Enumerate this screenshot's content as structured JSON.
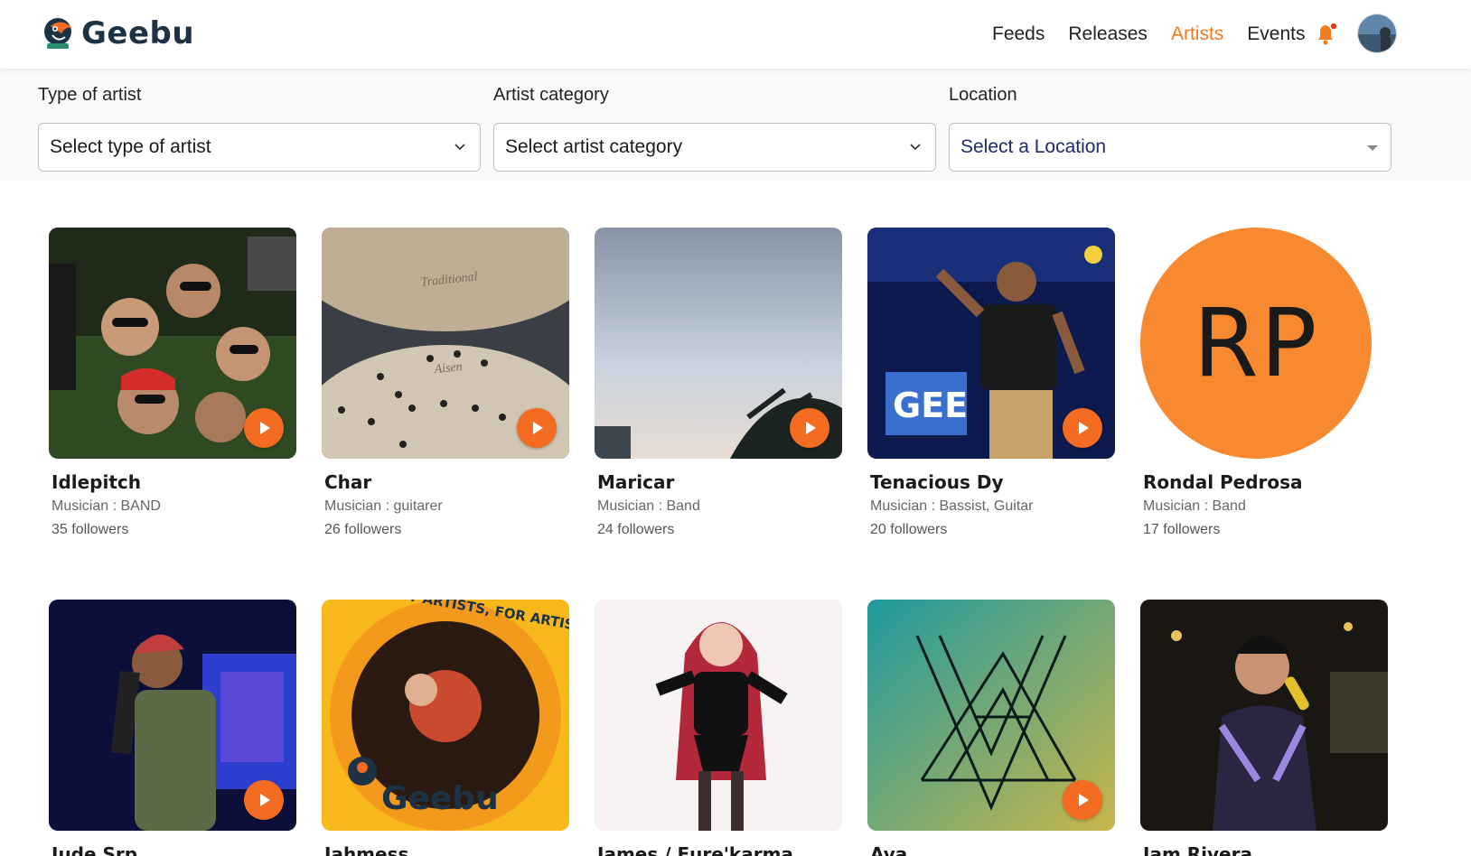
{
  "brand": {
    "name": "Geebu"
  },
  "nav": {
    "items": [
      {
        "label": "Feeds",
        "active": false
      },
      {
        "label": "Releases",
        "active": false
      },
      {
        "label": "Artists",
        "active": true
      },
      {
        "label": "Events",
        "active": false
      }
    ],
    "notification_icon": "bell-icon",
    "has_notification_dot": true
  },
  "filters": {
    "type": {
      "label": "Type of artist",
      "placeholder": "Select type of artist"
    },
    "category": {
      "label": "Artist category",
      "placeholder": "Select artist category"
    },
    "location": {
      "label": "Location",
      "placeholder": "Select a Location"
    }
  },
  "colors": {
    "accent": "#f47a20",
    "play": "#f36c21",
    "brand_text": "#1e3245"
  },
  "artists": [
    {
      "name": "Idlepitch",
      "role": "Musician : BAND",
      "followers": "35 followers"
    },
    {
      "name": "Char",
      "role": "Musician : guitarer",
      "followers": "26 followers"
    },
    {
      "name": "Maricar",
      "role": "Musician : Band",
      "followers": "24 followers"
    },
    {
      "name": "Tenacious Dy",
      "role": "Musician : Bassist, Guitar",
      "followers": "20 followers"
    },
    {
      "name": "Rondal Pedrosa",
      "role": "Musician : Band",
      "followers": "17 followers",
      "initials": "RP"
    },
    {
      "name": "Jude Srp",
      "role": "",
      "followers": ""
    },
    {
      "name": "Jahmess",
      "role": "",
      "followers": "",
      "badge_top": "BY ARTISTS, FOR ARTISTS",
      "badge_brand": "Geebu"
    },
    {
      "name": "James / Eure'karma",
      "role": "",
      "followers": ""
    },
    {
      "name": "Ava",
      "role": "",
      "followers": ""
    },
    {
      "name": "Jam Rivera",
      "role": "",
      "followers": ""
    }
  ]
}
